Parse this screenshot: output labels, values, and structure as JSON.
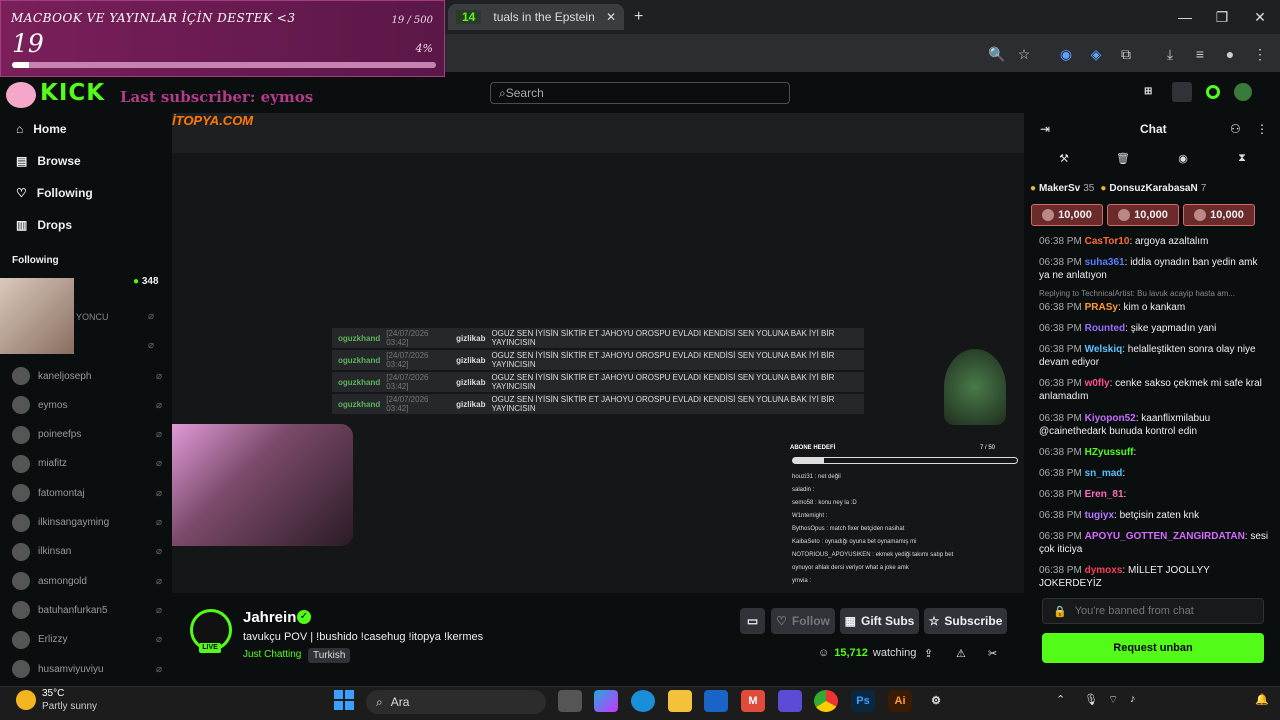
{
  "browser": {
    "tab_active_title": "tuals in the Epstein",
    "tab_badge": "14",
    "new_tab": "+",
    "minimize": "—",
    "maximize": "❐",
    "close": "✕"
  },
  "goal_overlay": {
    "title": "MACBOOK VE YAYINLAR İÇİN DESTEK <3",
    "count": "19",
    "fraction": "19 / 500",
    "percent": "4%",
    "progress": 0.04
  },
  "kick": {
    "logo": "KICK",
    "last_subscriber": "Last subscriber: eymos",
    "search_placeholder": "Search"
  },
  "sidebar": {
    "nav": [
      {
        "label": "Home",
        "icon": "home-icon"
      },
      {
        "label": "Browse",
        "icon": "browse-icon"
      },
      {
        "label": "Following",
        "icon": "heart-icon"
      },
      {
        "label": "Drops",
        "icon": "drops-icon"
      }
    ],
    "following_heading": "Following",
    "top_viewers": "348",
    "top_channel": "YONCU",
    "channels": [
      "kaneljoseph",
      "eymos",
      "poineefps",
      "miafitz",
      "fatomontaj",
      "ilkinsangayming",
      "ilkinsan",
      "asmongold",
      "batuhanfurkan5",
      "Erlizzy",
      "husamviyuviyu"
    ]
  },
  "video": {
    "overlay_chat": [
      {
        "user": "oguzkhand",
        "date": "[24/07/2026 03:42]",
        "user2": "gizlikab",
        "text": "OGUZ SEN İYİSİN SİKTİR ET JAHOYU OROSPU EVLADI KENDİSİ SEN YOLUNA BAK İYİ BİR YAYINCISIN"
      },
      {
        "user": "oguzkhand",
        "date": "[24/07/2026 03:42]",
        "user2": "gizlikab",
        "text": "OGUZ SEN İYİSİN SİKTİR ET JAHOYU OROSPU EVLADI KENDİSİ SEN YOLUNA BAK İYİ BİR YAYINCISIN"
      },
      {
        "user": "oguzkhand",
        "date": "[24/07/2026 03:42]",
        "user2": "gizlikab",
        "text": "OGUZ SEN İYİSİN SİKTİR ET JAHOYU OROSPU EVLADI KENDİSİ SEN YOLUNA BAK İYİ BİR YAYINCISIN"
      },
      {
        "user": "oguzkhand",
        "date": "[24/07/2026 03:42]",
        "user2": "gizlikab",
        "text": "OGUZ SEN İYİSİN SİKTİR ET JAHOYU OROSPU EVLADI KENDİSİ SEN YOLUNA BAK İYİ BİR YAYINCISIN"
      }
    ],
    "goal_label": "ABONE HEDEFİ",
    "goal_value": "7 / 50",
    "goal_progress": 0.14,
    "mini_chat": [
      "houzi31 : net değil",
      "saladin :",
      "semo58 : konu ney la :D",
      "W1ntemight :",
      "BythosOpus : match fixer betçiden nasihat",
      "KaibaSeto : oynadığı oyuna bet oynamamış mi",
      "NOTORIOUS_APOYUSIKEN : ekmek yediği takımı satıp bet",
      "oynuyor ahlak dersi veriyor what a joke amk",
      "ymvia :"
    ]
  },
  "stream": {
    "channel": "Jahrein",
    "live": "LIVE",
    "title": "tavukçu POV | !bushido !casehug !itopya !kermes",
    "category": "Just Chatting",
    "language": "Turkish",
    "follow": "Follow",
    "gift_subs": "Gift Subs",
    "subscribe": "Subscribe",
    "viewers": "15,712",
    "watching_label": "watching"
  },
  "chat": {
    "title": "Chat",
    "pinned": [
      {
        "name": "MakerSv",
        "count": "35"
      },
      {
        "name": "DonsuzKarabasaN",
        "count": "7"
      }
    ],
    "gifts": [
      "10,000",
      "10,000",
      "10,000"
    ],
    "messages": [
      {
        "time": "06:38 PM",
        "user": "CasTor10",
        "color": "#ff6b3d",
        "text": "argoya azaltalım"
      },
      {
        "time": "06:38 PM",
        "user": "suha361",
        "color": "#5b7cff",
        "text": "iddia oynadın ban yedin amk ya ne anlatıyon"
      },
      {
        "time": "",
        "user": "",
        "color": "#888888",
        "text": "Replying to TechnicalArtist: Bu lavuk acayip hasta am..."
      },
      {
        "time": "06:38 PM",
        "user": "PRASy",
        "color": "#ff9a2e",
        "text": "kim o kankam"
      },
      {
        "time": "06:38 PM",
        "user": "Rounted",
        "color": "#9b6bff",
        "text": "şike yapmadın yani"
      },
      {
        "time": "06:38 PM",
        "user": "Welskiq",
        "color": "#5ec2ff",
        "text": "helalleştikten sonra olay niye devam ediyor"
      },
      {
        "time": "06:38 PM",
        "user": "w0fly",
        "color": "#ff4f8b",
        "text": "cenke sakso çekmek mi safe kral anlamadım"
      },
      {
        "time": "06:38 PM",
        "user": "Kiyopon52",
        "color": "#c56bff",
        "text": "kaanflixmilabuu @cainethedark bunuda kontrol edin"
      },
      {
        "time": "06:38 PM",
        "user": "HZyussuff",
        "color": "#53fc18",
        "text": ""
      },
      {
        "time": "06:38 PM",
        "user": "sn_mad",
        "color": "#53c3ff",
        "text": ""
      },
      {
        "time": "06:38 PM",
        "user": "Eren_81",
        "color": "#ff6bc0",
        "text": ""
      },
      {
        "time": "06:38 PM",
        "user": "tugiyx",
        "color": "#b77bff",
        "text": "betçisin zaten knk"
      },
      {
        "time": "06:38 PM",
        "user": "APOYU_GOTTEN_ZANGIRDATAN",
        "color": "#d56bff",
        "text": "sesi çok iticiya"
      },
      {
        "time": "06:38 PM",
        "user": "dymoxs",
        "color": "#ff3d5a",
        "text": "MİLLET JOOLLYY JOKERDEYİZ"
      }
    ],
    "banned_placeholder": "You're banned from chat",
    "unban_button": "Request unban"
  },
  "taskbar": {
    "temperature": "35°C",
    "weather": "Partly sunny",
    "search": "Ara",
    "apps": [
      "File Explorer",
      "Copilot",
      "Edge",
      "Folder",
      "Outlook",
      "Gmail",
      "Video",
      "Chrome",
      "Ps",
      "Ai"
    ]
  }
}
